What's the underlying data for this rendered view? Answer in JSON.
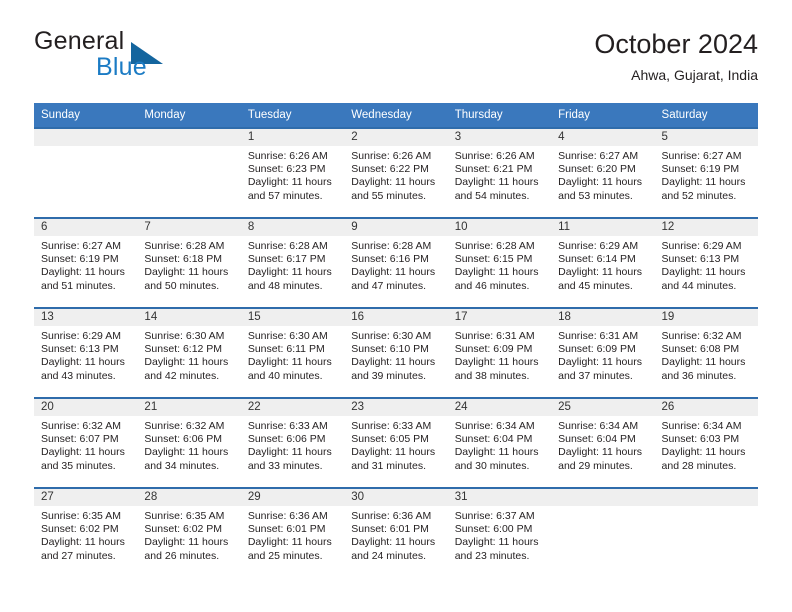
{
  "brand": {
    "line1": "General",
    "line2": "Blue",
    "triangle_icon": "blue-triangle-icon",
    "color_dark": "#231f20",
    "color_blue": "#1b7bc4"
  },
  "header": {
    "title": "October 2024",
    "subtitle": "Ahwa, Gujarat, India"
  },
  "theme": {
    "header_bg": "#3a78bd",
    "row_rule": "#2f6cab",
    "daynum_bg": "#efefef",
    "text": "#231f20"
  },
  "calendar": {
    "weekdays": [
      "Sunday",
      "Monday",
      "Tuesday",
      "Wednesday",
      "Thursday",
      "Friday",
      "Saturday"
    ],
    "labels": {
      "sunrise": "Sunrise:",
      "sunset": "Sunset:",
      "daylight": "Daylight:"
    },
    "weeks": [
      [
        {
          "day": "",
          "sunrise": "",
          "sunset": "",
          "daylight_line1": "",
          "daylight_line2": ""
        },
        {
          "day": "",
          "sunrise": "",
          "sunset": "",
          "daylight_line1": "",
          "daylight_line2": ""
        },
        {
          "day": "1",
          "sunrise": "Sunrise: 6:26 AM",
          "sunset": "Sunset: 6:23 PM",
          "daylight_line1": "Daylight: 11 hours",
          "daylight_line2": "and 57 minutes."
        },
        {
          "day": "2",
          "sunrise": "Sunrise: 6:26 AM",
          "sunset": "Sunset: 6:22 PM",
          "daylight_line1": "Daylight: 11 hours",
          "daylight_line2": "and 55 minutes."
        },
        {
          "day": "3",
          "sunrise": "Sunrise: 6:26 AM",
          "sunset": "Sunset: 6:21 PM",
          "daylight_line1": "Daylight: 11 hours",
          "daylight_line2": "and 54 minutes."
        },
        {
          "day": "4",
          "sunrise": "Sunrise: 6:27 AM",
          "sunset": "Sunset: 6:20 PM",
          "daylight_line1": "Daylight: 11 hours",
          "daylight_line2": "and 53 minutes."
        },
        {
          "day": "5",
          "sunrise": "Sunrise: 6:27 AM",
          "sunset": "Sunset: 6:19 PM",
          "daylight_line1": "Daylight: 11 hours",
          "daylight_line2": "and 52 minutes."
        }
      ],
      [
        {
          "day": "6",
          "sunrise": "Sunrise: 6:27 AM",
          "sunset": "Sunset: 6:19 PM",
          "daylight_line1": "Daylight: 11 hours",
          "daylight_line2": "and 51 minutes."
        },
        {
          "day": "7",
          "sunrise": "Sunrise: 6:28 AM",
          "sunset": "Sunset: 6:18 PM",
          "daylight_line1": "Daylight: 11 hours",
          "daylight_line2": "and 50 minutes."
        },
        {
          "day": "8",
          "sunrise": "Sunrise: 6:28 AM",
          "sunset": "Sunset: 6:17 PM",
          "daylight_line1": "Daylight: 11 hours",
          "daylight_line2": "and 48 minutes."
        },
        {
          "day": "9",
          "sunrise": "Sunrise: 6:28 AM",
          "sunset": "Sunset: 6:16 PM",
          "daylight_line1": "Daylight: 11 hours",
          "daylight_line2": "and 47 minutes."
        },
        {
          "day": "10",
          "sunrise": "Sunrise: 6:28 AM",
          "sunset": "Sunset: 6:15 PM",
          "daylight_line1": "Daylight: 11 hours",
          "daylight_line2": "and 46 minutes."
        },
        {
          "day": "11",
          "sunrise": "Sunrise: 6:29 AM",
          "sunset": "Sunset: 6:14 PM",
          "daylight_line1": "Daylight: 11 hours",
          "daylight_line2": "and 45 minutes."
        },
        {
          "day": "12",
          "sunrise": "Sunrise: 6:29 AM",
          "sunset": "Sunset: 6:13 PM",
          "daylight_line1": "Daylight: 11 hours",
          "daylight_line2": "and 44 minutes."
        }
      ],
      [
        {
          "day": "13",
          "sunrise": "Sunrise: 6:29 AM",
          "sunset": "Sunset: 6:13 PM",
          "daylight_line1": "Daylight: 11 hours",
          "daylight_line2": "and 43 minutes."
        },
        {
          "day": "14",
          "sunrise": "Sunrise: 6:30 AM",
          "sunset": "Sunset: 6:12 PM",
          "daylight_line1": "Daylight: 11 hours",
          "daylight_line2": "and 42 minutes."
        },
        {
          "day": "15",
          "sunrise": "Sunrise: 6:30 AM",
          "sunset": "Sunset: 6:11 PM",
          "daylight_line1": "Daylight: 11 hours",
          "daylight_line2": "and 40 minutes."
        },
        {
          "day": "16",
          "sunrise": "Sunrise: 6:30 AM",
          "sunset": "Sunset: 6:10 PM",
          "daylight_line1": "Daylight: 11 hours",
          "daylight_line2": "and 39 minutes."
        },
        {
          "day": "17",
          "sunrise": "Sunrise: 6:31 AM",
          "sunset": "Sunset: 6:09 PM",
          "daylight_line1": "Daylight: 11 hours",
          "daylight_line2": "and 38 minutes."
        },
        {
          "day": "18",
          "sunrise": "Sunrise: 6:31 AM",
          "sunset": "Sunset: 6:09 PM",
          "daylight_line1": "Daylight: 11 hours",
          "daylight_line2": "and 37 minutes."
        },
        {
          "day": "19",
          "sunrise": "Sunrise: 6:32 AM",
          "sunset": "Sunset: 6:08 PM",
          "daylight_line1": "Daylight: 11 hours",
          "daylight_line2": "and 36 minutes."
        }
      ],
      [
        {
          "day": "20",
          "sunrise": "Sunrise: 6:32 AM",
          "sunset": "Sunset: 6:07 PM",
          "daylight_line1": "Daylight: 11 hours",
          "daylight_line2": "and 35 minutes."
        },
        {
          "day": "21",
          "sunrise": "Sunrise: 6:32 AM",
          "sunset": "Sunset: 6:06 PM",
          "daylight_line1": "Daylight: 11 hours",
          "daylight_line2": "and 34 minutes."
        },
        {
          "day": "22",
          "sunrise": "Sunrise: 6:33 AM",
          "sunset": "Sunset: 6:06 PM",
          "daylight_line1": "Daylight: 11 hours",
          "daylight_line2": "and 33 minutes."
        },
        {
          "day": "23",
          "sunrise": "Sunrise: 6:33 AM",
          "sunset": "Sunset: 6:05 PM",
          "daylight_line1": "Daylight: 11 hours",
          "daylight_line2": "and 31 minutes."
        },
        {
          "day": "24",
          "sunrise": "Sunrise: 6:34 AM",
          "sunset": "Sunset: 6:04 PM",
          "daylight_line1": "Daylight: 11 hours",
          "daylight_line2": "and 30 minutes."
        },
        {
          "day": "25",
          "sunrise": "Sunrise: 6:34 AM",
          "sunset": "Sunset: 6:04 PM",
          "daylight_line1": "Daylight: 11 hours",
          "daylight_line2": "and 29 minutes."
        },
        {
          "day": "26",
          "sunrise": "Sunrise: 6:34 AM",
          "sunset": "Sunset: 6:03 PM",
          "daylight_line1": "Daylight: 11 hours",
          "daylight_line2": "and 28 minutes."
        }
      ],
      [
        {
          "day": "27",
          "sunrise": "Sunrise: 6:35 AM",
          "sunset": "Sunset: 6:02 PM",
          "daylight_line1": "Daylight: 11 hours",
          "daylight_line2": "and 27 minutes."
        },
        {
          "day": "28",
          "sunrise": "Sunrise: 6:35 AM",
          "sunset": "Sunset: 6:02 PM",
          "daylight_line1": "Daylight: 11 hours",
          "daylight_line2": "and 26 minutes."
        },
        {
          "day": "29",
          "sunrise": "Sunrise: 6:36 AM",
          "sunset": "Sunset: 6:01 PM",
          "daylight_line1": "Daylight: 11 hours",
          "daylight_line2": "and 25 minutes."
        },
        {
          "day": "30",
          "sunrise": "Sunrise: 6:36 AM",
          "sunset": "Sunset: 6:01 PM",
          "daylight_line1": "Daylight: 11 hours",
          "daylight_line2": "and 24 minutes."
        },
        {
          "day": "31",
          "sunrise": "Sunrise: 6:37 AM",
          "sunset": "Sunset: 6:00 PM",
          "daylight_line1": "Daylight: 11 hours",
          "daylight_line2": "and 23 minutes."
        },
        {
          "day": "",
          "sunrise": "",
          "sunset": "",
          "daylight_line1": "",
          "daylight_line2": ""
        },
        {
          "day": "",
          "sunrise": "",
          "sunset": "",
          "daylight_line1": "",
          "daylight_line2": ""
        }
      ]
    ]
  }
}
